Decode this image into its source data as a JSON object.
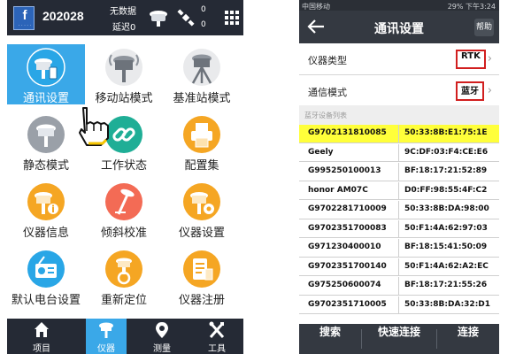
{
  "left_phone": {
    "top_bar": {
      "device_id": "202028",
      "status_line1": "无数据",
      "status_line2": "延迟0",
      "count_top": "0",
      "count_bottom": "0",
      "logo_letter": "f",
      "icons": [
        "rtk-receiver-icon",
        "satellite-icon",
        "grid-menu-icon"
      ]
    },
    "tiles": [
      {
        "label": "通讯设置",
        "icon": "receiver-phone-icon",
        "color": "#29a6e6",
        "active": true
      },
      {
        "label": "移动站模式",
        "icon": "rover-receiver-icon",
        "color": "#e9eaec",
        "active": false
      },
      {
        "label": "基准站模式",
        "icon": "base-station-icon",
        "color": "#e9eaec",
        "active": false
      },
      {
        "label": "静态模式",
        "icon": "static-receiver-icon",
        "color": "#9aa0a8",
        "active": false
      },
      {
        "label": "工作状态",
        "icon": "chain-link-icon",
        "color": "#1fae96",
        "active": false
      },
      {
        "label": "配置集",
        "icon": "printer-icon",
        "color": "#f5a623",
        "active": false
      },
      {
        "label": "仪器信息",
        "icon": "receiver-info-icon",
        "color": "#f5a623",
        "active": false
      },
      {
        "label": "倾斜校准",
        "icon": "tilt-calibration-icon",
        "color": "#f36b55",
        "active": false
      },
      {
        "label": "仪器设置",
        "icon": "receiver-settings-icon",
        "color": "#f5a623",
        "active": false
      },
      {
        "label": "默认电台设置",
        "icon": "radio-icon",
        "color": "#29a6e6",
        "active": false
      },
      {
        "label": "重新定位",
        "icon": "relocate-icon",
        "color": "#f5a623",
        "active": false
      },
      {
        "label": "仪器注册",
        "icon": "register-icon",
        "color": "#f5a623",
        "active": false
      }
    ],
    "bottom_nav": [
      {
        "label": "项目",
        "icon": "home-icon",
        "active": false
      },
      {
        "label": "仪器",
        "icon": "receiver-icon",
        "active": true
      },
      {
        "label": "测量",
        "icon": "location-pin-icon",
        "active": false
      },
      {
        "label": "工具",
        "icon": "tools-icon",
        "active": false
      }
    ]
  },
  "right_phone": {
    "status_bar": {
      "carrier": "中国移动",
      "right": "29%  下午3:24"
    },
    "title": "通讯设置",
    "help_label": "帮助",
    "instrument_type": {
      "label": "仪器类型",
      "value": "RTK"
    },
    "comm_mode": {
      "label": "通信模式",
      "value": "蓝牙"
    },
    "bluetooth_list_header": "蓝牙设备列表",
    "devices": [
      {
        "name": "G9702131810085",
        "mac": "50:33:8B:E1:75:1E",
        "highlighted": true
      },
      {
        "name": "Geely",
        "mac": "9C:DF:03:F4:CE:E6",
        "highlighted": false
      },
      {
        "name": "G995250100013",
        "mac": "BF:18:17:21:52:89",
        "highlighted": false
      },
      {
        "name": "honor AM07C",
        "mac": "D0:FF:98:55:4F:C2",
        "highlighted": false
      },
      {
        "name": "G9702281710009",
        "mac": "50:33:8B:DA:98:00",
        "highlighted": false
      },
      {
        "name": "G9702351700083",
        "mac": "50:F1:4A:62:97:03",
        "highlighted": false
      },
      {
        "name": "G971230400010",
        "mac": "BF:18:15:41:50:09",
        "highlighted": false
      },
      {
        "name": "G9702351700140",
        "mac": "50:F1:4A:62:A2:EC",
        "highlighted": false
      },
      {
        "name": "G975250600074",
        "mac": "BF:18:17:21:55:26",
        "highlighted": false
      },
      {
        "name": "G9702351710005",
        "mac": "50:33:8B:DA:32:D1",
        "highlighted": false
      }
    ],
    "bottom_buttons": [
      "搜索",
      "快速连接",
      "连接"
    ]
  },
  "colors": {
    "dark_bar": "#252a35",
    "accent_blue": "#3aa8e8",
    "highlight_yellow": "#ffff3a",
    "annotation_red": "#d11f1f"
  }
}
